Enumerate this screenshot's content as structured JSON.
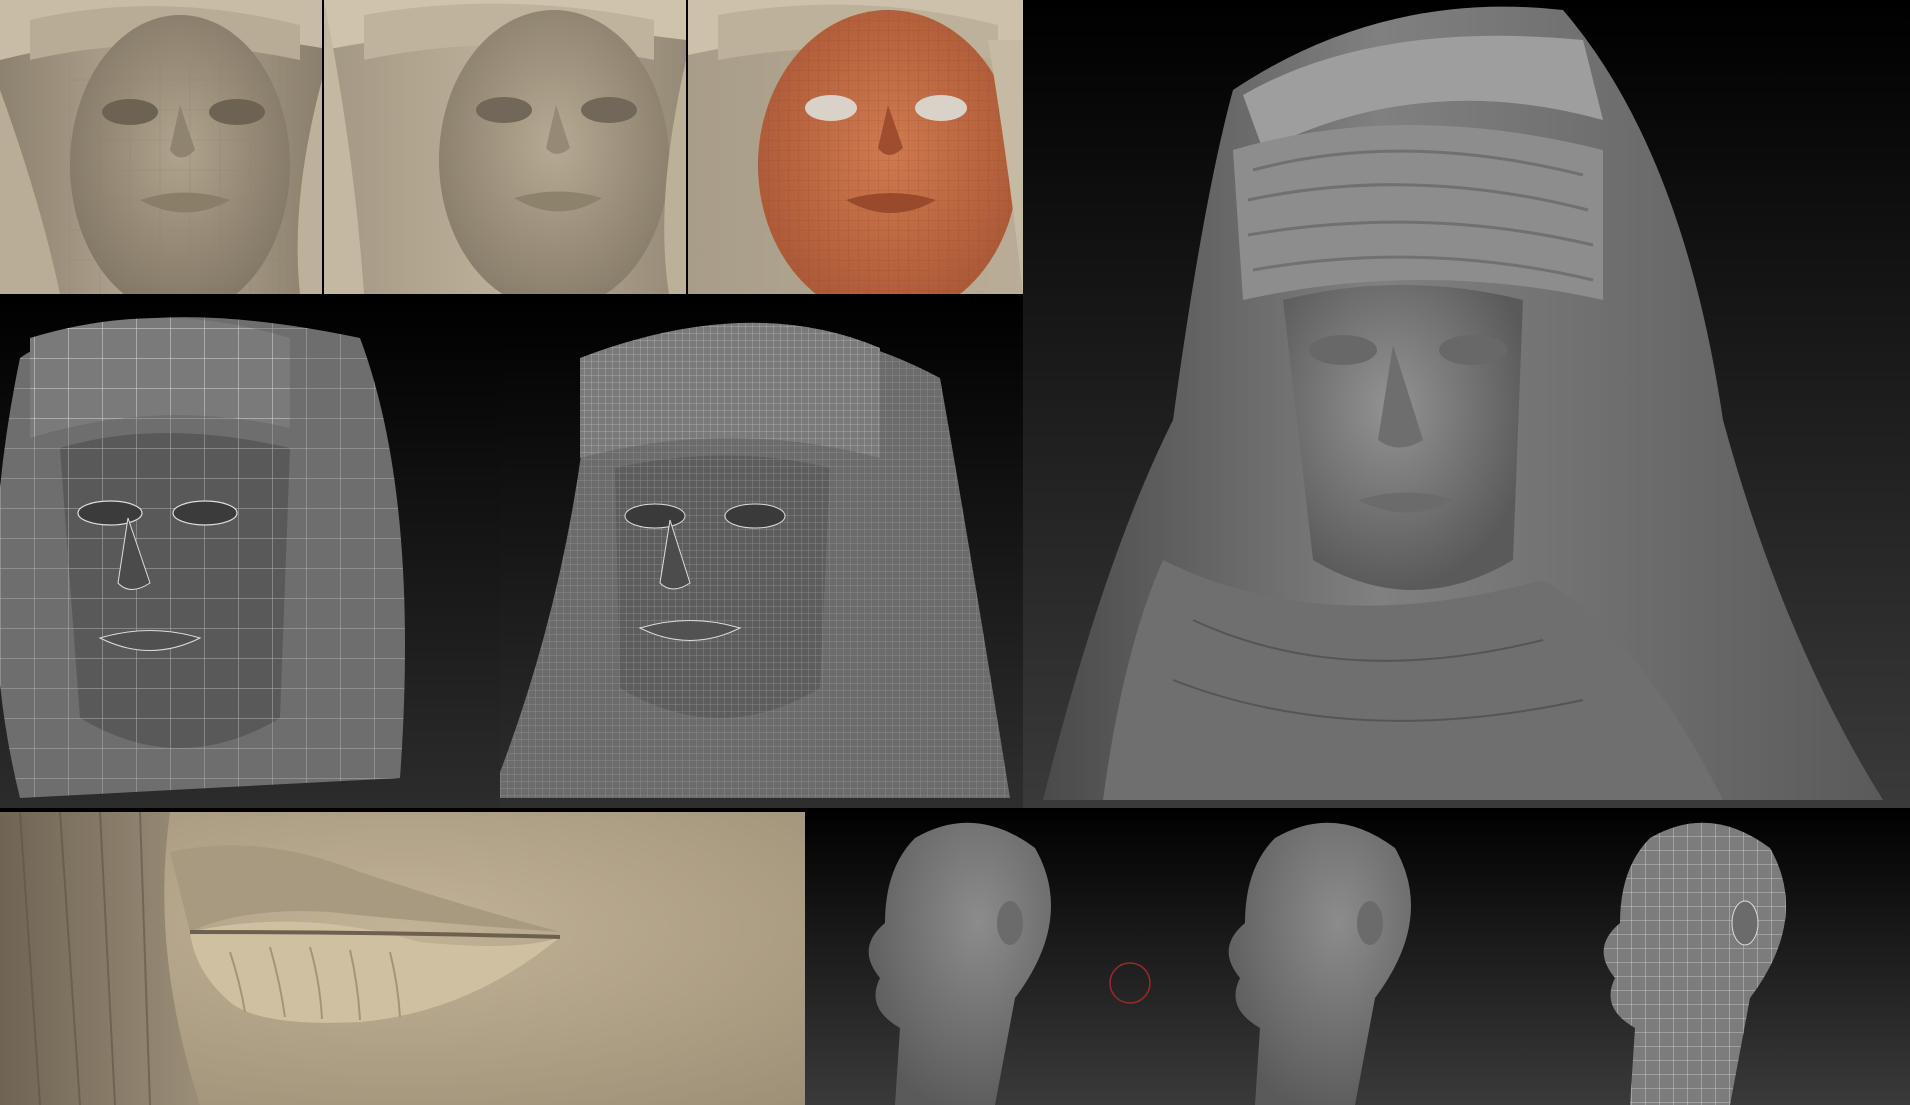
{
  "image": {
    "panels": [
      {
        "name": "front-face-lowres-tan",
        "color": "#a39883"
      },
      {
        "name": "front-face-smooth-tan",
        "color": "#a89d88"
      },
      {
        "name": "front-face-polypaint-orange",
        "color": "#c26a44"
      },
      {
        "name": "wireframe-low-poly-grey",
        "color": "#707070"
      },
      {
        "name": "wireframe-high-poly-grey",
        "color": "#6e6e6e"
      },
      {
        "name": "hero-sculpt-grey",
        "color": "#7a7a7a"
      },
      {
        "name": "lips-closeup-tan",
        "color": "#b2a389"
      },
      {
        "name": "head-profile-grey",
        "color": "#7c7c7c"
      }
    ]
  }
}
